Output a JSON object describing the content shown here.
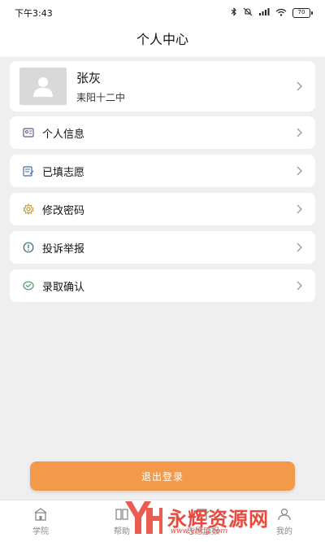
{
  "status_bar": {
    "time": "下午3:43",
    "battery": "70",
    "icons": [
      "bluetooth-icon",
      "mute-icon",
      "signal-icon",
      "wifi-icon",
      "battery-icon"
    ]
  },
  "header": {
    "title": "个人中心"
  },
  "profile": {
    "name": "张灰",
    "school": "耒阳十二中"
  },
  "menu": [
    {
      "label": "个人信息",
      "icon": "id-card-icon",
      "color": "#5b5b8f"
    },
    {
      "label": "已填志愿",
      "icon": "form-list-icon",
      "color": "#3f6fa8"
    },
    {
      "label": "修改密码",
      "icon": "gear-icon",
      "color": "#c99a2e"
    },
    {
      "label": "投诉举报",
      "icon": "info-circle-icon",
      "color": "#2f6f7a"
    },
    {
      "label": "录取确认",
      "icon": "check-circle-icon",
      "color": "#4e9b6a"
    }
  ],
  "logout_label": "退出登录",
  "tabs": [
    {
      "label": "学院",
      "icon": "school-icon"
    },
    {
      "label": "帮助",
      "icon": "book-icon"
    },
    {
      "label": "志愿填报",
      "icon": "edit-icon"
    },
    {
      "label": "我的",
      "icon": "user-icon"
    }
  ],
  "watermark": {
    "text": "永辉资源网",
    "url": "www.yhkjjj.com"
  },
  "colors": {
    "accent": "#f3994a",
    "background": "#efefef",
    "watermark": "#e84a3f"
  }
}
